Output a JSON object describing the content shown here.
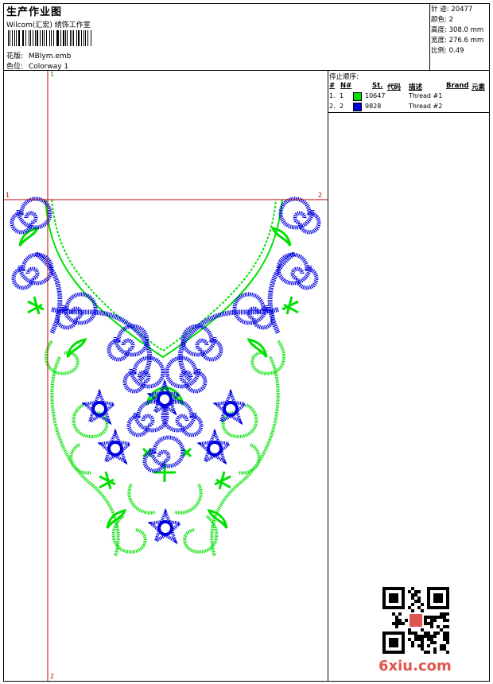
{
  "header": {
    "title": "生产作业图",
    "studio": "Wilcom(汇宏) 绣饰工作室",
    "design_label": "花版:",
    "design_value": "MBlym.emb",
    "color_label": "色位:",
    "color_value": "Colorway 1"
  },
  "stats": {
    "stitches_label": "针 迹:",
    "stitches_value": "20477",
    "colors_label": "颜色:",
    "colors_value": "2",
    "height_label": "高度:",
    "height_value": "308.0 mm",
    "width_label": "宽度:",
    "width_value": "276.6 mm",
    "scale_label": "比例:",
    "scale_value": "0.49"
  },
  "stop_sequence": {
    "title": "停止顺序:",
    "columns": [
      "#",
      "N#",
      "St.",
      "代码",
      "描述",
      "Brand",
      "元素"
    ],
    "rows": [
      {
        "index": "1.",
        "needle": "1",
        "color": "#00e000",
        "code": "10647",
        "description": "Thread #1"
      },
      {
        "index": "2.",
        "needle": "2",
        "color": "#0000e0",
        "code": "9828",
        "description": "Thread #2"
      }
    ]
  },
  "guides": {
    "top_marker": "1",
    "left_marker": "1",
    "right_marker": "2",
    "bottom_marker": "2"
  },
  "colors": {
    "thread_green": "#00e000",
    "thread_blue": "#0000e0",
    "guide_red": "#c00000",
    "watermark_red": "#e0554f"
  },
  "watermark": "6xiu.com"
}
